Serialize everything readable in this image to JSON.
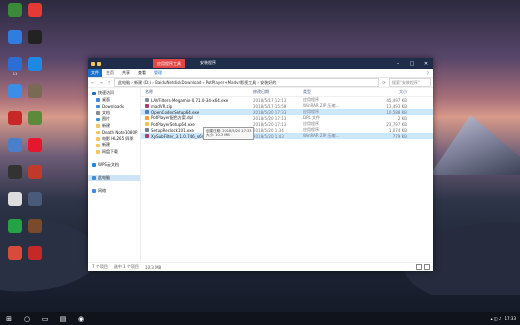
{
  "colors": {
    "titlebar": "#1f2d4a",
    "accent": "#1a6fc8",
    "selection": "#cce8ff",
    "context_tab": "#e04848"
  },
  "desktop_icons": [
    {
      "label": "",
      "icon": "app-green-icon",
      "color": "#3a8a3a"
    },
    {
      "label": "",
      "icon": "app-blue-icon",
      "color": "#2f7de0"
    },
    {
      "label": "11",
      "icon": "app-11-icon",
      "color": "#2b6fd6"
    },
    {
      "label": "",
      "icon": "app-blue2-icon",
      "color": "#3b8de6"
    },
    {
      "label": "",
      "icon": "app-red-icon",
      "color": "#c62828"
    },
    {
      "label": "",
      "icon": "app-wheel-icon",
      "color": "#4a7fc9"
    },
    {
      "label": "",
      "icon": "app-dark-icon",
      "color": "#333"
    },
    {
      "label": "",
      "icon": "app-skull-icon",
      "color": "#ddd"
    },
    {
      "label": "",
      "icon": "app-green2-icon",
      "color": "#25a244"
    },
    {
      "label": "",
      "icon": "app-diamond-icon",
      "color": "#d84b3a"
    },
    {
      "label": "",
      "icon": "app-red2-icon",
      "color": "#e53935"
    },
    {
      "label": "",
      "icon": "app-penguin-icon",
      "color": "#222"
    },
    {
      "label": "",
      "icon": "app-edge-icon",
      "color": "#1e88e5"
    },
    {
      "label": "",
      "icon": "app-game-icon",
      "color": "#7a6a55"
    },
    {
      "label": "",
      "icon": "app-game2-icon",
      "color": "#5a8a3a"
    },
    {
      "label": "",
      "icon": "app-weibo-icon",
      "color": "#e6162d"
    },
    {
      "label": "",
      "icon": "app-red3-icon",
      "color": "#c0392b"
    },
    {
      "label": "",
      "icon": "app-tool-icon",
      "color": "#4a5b7a"
    },
    {
      "label": "",
      "icon": "app-game3-icon",
      "color": "#7b4a2a"
    },
    {
      "label": "",
      "icon": "app-red4-icon",
      "color": "#c62828"
    }
  ],
  "window": {
    "context_tab": "应用程序工具",
    "title": "安装程序",
    "ribbon_tabs": [
      "文件",
      "主页",
      "共享",
      "查看",
      "管理"
    ],
    "address_path": "此电脑 › 新建 (D:) › BaiduNetdiskDownload › PotPlayer+Madvr影视工具 › 安装好的",
    "search_placeholder": "搜索\"安装程序\"",
    "nav": [
      {
        "label": "快速访问",
        "icon": "star-icon",
        "color": "#1a6fc8",
        "sub": false,
        "sel": false
      },
      {
        "label": "桌面",
        "icon": "desktop-icon",
        "color": "#3a8de0",
        "sub": true,
        "sel": false
      },
      {
        "label": "Downloads",
        "icon": "download-icon",
        "color": "#3a8de0",
        "sub": true,
        "sel": false
      },
      {
        "label": "文档",
        "icon": "doc-icon",
        "color": "#8a8a8a",
        "sub": true,
        "sel": false
      },
      {
        "label": "图片",
        "icon": "picture-icon",
        "color": "#3a8de0",
        "sub": true,
        "sel": false
      },
      {
        "label": "新建",
        "icon": "folder-icon",
        "color": "#f3c65b",
        "sub": true,
        "sel": false
      },
      {
        "label": "Death Note1080P",
        "icon": "folder-icon",
        "color": "#f3c65b",
        "sub": true,
        "sel": false
      },
      {
        "label": "电影 HL265 四季",
        "icon": "folder-icon",
        "color": "#f3c65b",
        "sub": true,
        "sel": false
      },
      {
        "label": "新建",
        "icon": "folder-icon",
        "color": "#f3c65b",
        "sub": true,
        "sel": false
      },
      {
        "label": "网盘下载",
        "icon": "folder-icon",
        "color": "#f3c65b",
        "sub": true,
        "sel": false
      },
      {
        "label": "",
        "icon": "",
        "color": "",
        "sub": false,
        "sel": false
      },
      {
        "label": "WPS云文档",
        "icon": "cloud-icon",
        "color": "#1e88e5",
        "sub": false,
        "sel": false
      },
      {
        "label": "",
        "icon": "",
        "color": "",
        "sub": false,
        "sel": false
      },
      {
        "label": "此电脑",
        "icon": "computer-icon",
        "color": "#3a8de0",
        "sub": false,
        "sel": true
      },
      {
        "label": "",
        "icon": "",
        "color": "",
        "sub": false,
        "sel": false
      },
      {
        "label": "网络",
        "icon": "network-icon",
        "color": "#3a8de0",
        "sub": false,
        "sel": false
      }
    ],
    "columns": {
      "name": "名称",
      "date": "修改日期",
      "type": "类型",
      "size": "大小"
    },
    "files": [
      {
        "name": "LAVFilters-Megamix-0.71.0-34-x64.exe",
        "date": "2018/5/17 12:13",
        "type": "应用程序",
        "size": "45,497 KB",
        "color": "#7a8aa8",
        "sel": false
      },
      {
        "name": "madVR.zip",
        "date": "2018/5/17 15:58",
        "type": "WinRAR ZIP 压缩...",
        "size": "13,493 KB",
        "color": "#b23a6c",
        "sel": false
      },
      {
        "name": "OpenCodecSetup64.exe",
        "date": "2018/5/20 17:33",
        "type": "应用程序",
        "size": "10,588 KB",
        "color": "#4a7fc9",
        "sel": true
      },
      {
        "name": "PotPlayer配色方案.dpl",
        "date": "2018/5/20 17:13",
        "type": "DPL 文件",
        "size": "2 KB",
        "color": "#f0a030",
        "sel": false
      },
      {
        "name": "PotPlayerSetup64.exe",
        "date": "2018/5/20 17:13",
        "type": "应用程序",
        "size": "23,797 KB",
        "color": "#f6c343",
        "sel": false
      },
      {
        "name": "SetupReclock101.exe",
        "date": "2018/5/20 1:34",
        "type": "应用程序",
        "size": "1,074 KB",
        "color": "#6a7fa0",
        "sel": false
      },
      {
        "name": "XySubFilter_3.1.0.746_x64_BETA3.zip",
        "date": "2018/5/20 1:43",
        "type": "WinRAR ZIP 压缩...",
        "size": "779 KB",
        "color": "#b23a6c",
        "sel": true
      }
    ],
    "tooltip": [
      "创建日期: 2018/5/20 17:33",
      "大小: 10.3 MB"
    ],
    "status": {
      "count": "7 个项目",
      "selected": "选中 1 个项目",
      "size": "10.3 MB"
    }
  },
  "taskbar": {
    "items": [
      {
        "icon": "windows-start-icon",
        "glyph": "⊞"
      },
      {
        "icon": "search-icon",
        "glyph": "○"
      },
      {
        "icon": "task-view-icon",
        "glyph": "▭"
      },
      {
        "icon": "file-explorer-icon",
        "glyph": "▤"
      },
      {
        "icon": "browser-icon",
        "glyph": "◉"
      }
    ],
    "time": "17:33"
  }
}
